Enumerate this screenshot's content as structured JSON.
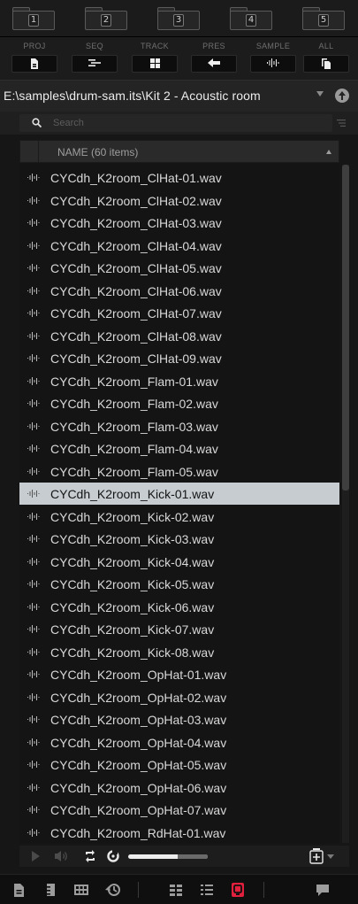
{
  "folders": [
    "1",
    "2",
    "3",
    "4",
    "5"
  ],
  "filters": [
    {
      "label": "PROJ",
      "icon": "project-icon"
    },
    {
      "label": "SEQ",
      "icon": "sequence-icon"
    },
    {
      "label": "TRACK",
      "icon": "track-icon"
    },
    {
      "label": "PRES",
      "icon": "preset-icon"
    },
    {
      "label": "SAMPLE",
      "icon": "sample-icon"
    },
    {
      "label": "ALL",
      "icon": "all-icon"
    }
  ],
  "path": "E:\\samples\\drum-sam.its\\Kit 2 - Acoustic room",
  "search": {
    "placeholder": "Search"
  },
  "list_header": {
    "name_col": "NAME (60 items)"
  },
  "files": [
    "CYCdh_K2room_ClHat-01.wav",
    "CYCdh_K2room_ClHat-02.wav",
    "CYCdh_K2room_ClHat-03.wav",
    "CYCdh_K2room_ClHat-04.wav",
    "CYCdh_K2room_ClHat-05.wav",
    "CYCdh_K2room_ClHat-06.wav",
    "CYCdh_K2room_ClHat-07.wav",
    "CYCdh_K2room_ClHat-08.wav",
    "CYCdh_K2room_ClHat-09.wav",
    "CYCdh_K2room_Flam-01.wav",
    "CYCdh_K2room_Flam-02.wav",
    "CYCdh_K2room_Flam-03.wav",
    "CYCdh_K2room_Flam-04.wav",
    "CYCdh_K2room_Flam-05.wav",
    "CYCdh_K2room_Kick-01.wav",
    "CYCdh_K2room_Kick-02.wav",
    "CYCdh_K2room_Kick-03.wav",
    "CYCdh_K2room_Kick-04.wav",
    "CYCdh_K2room_Kick-05.wav",
    "CYCdh_K2room_Kick-06.wav",
    "CYCdh_K2room_Kick-07.wav",
    "CYCdh_K2room_Kick-08.wav",
    "CYCdh_K2room_OpHat-01.wav",
    "CYCdh_K2room_OpHat-02.wav",
    "CYCdh_K2room_OpHat-03.wav",
    "CYCdh_K2room_OpHat-04.wav",
    "CYCdh_K2room_OpHat-05.wav",
    "CYCdh_K2room_OpHat-06.wav",
    "CYCdh_K2room_OpHat-07.wav",
    "CYCdh_K2room_RdHat-01.wav"
  ],
  "selected_index": 14,
  "preview": {
    "volume_fraction": 0.62
  },
  "colors": {
    "selected_row": "#c6ccd0",
    "accent": "#e0203c",
    "background": "#161616"
  }
}
